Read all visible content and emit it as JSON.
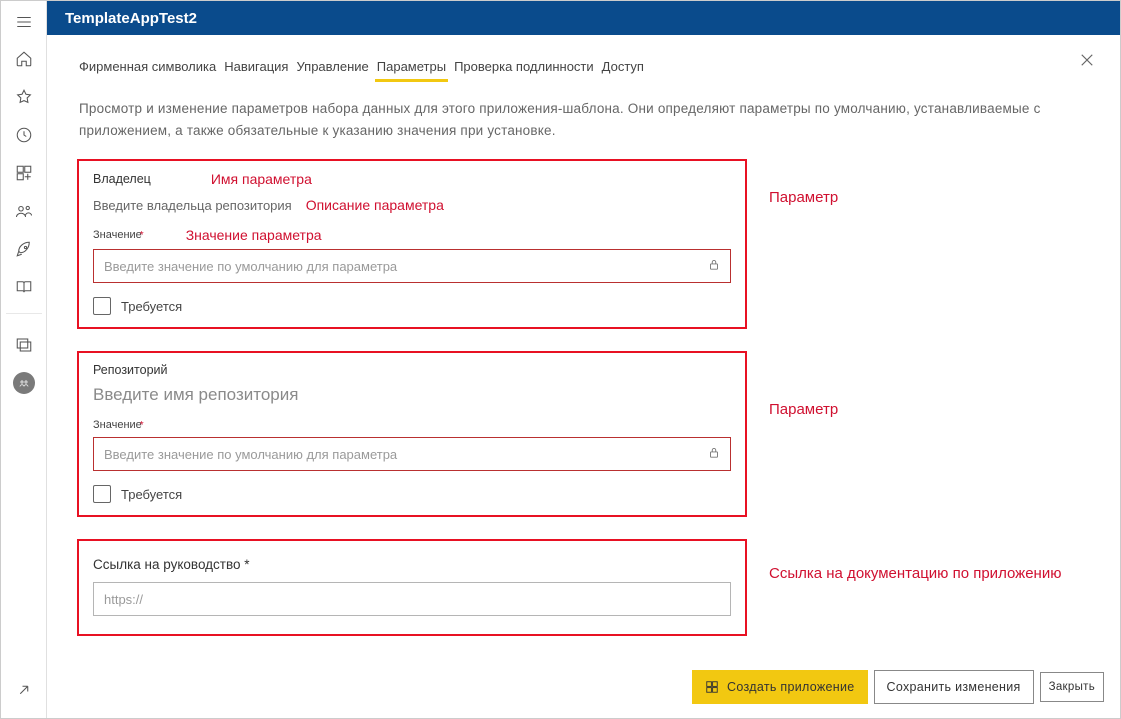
{
  "header": {
    "title": "TemplateAppTest2"
  },
  "tabs": [
    {
      "label": "Фирменная символика"
    },
    {
      "label": "Навигация"
    },
    {
      "label": "Управление"
    },
    {
      "label": "Параметры",
      "active": true
    },
    {
      "label": "Проверка подлинности"
    },
    {
      "label": "Доступ"
    }
  ],
  "description": "Просмотр и изменение параметров набора данных для этого приложения-шаблона. Они определяют параметры по умолчанию, устанавливаемые с приложением, а также обязательные к указанию значения при установке.",
  "param1": {
    "name": "Владелец",
    "name_hint": "Имя параметра",
    "desc": "Введите владельца репозитория",
    "desc_hint": "Описание параметра",
    "value_label": "Значение",
    "value_hint": "Значение параметра",
    "placeholder": "Введите значение по умолчанию для параметра",
    "required_label": "Требуется",
    "annotation": "Параметр"
  },
  "param2": {
    "name": "Репозиторий",
    "desc": "Введите имя репозитория",
    "value_label": "Значение",
    "placeholder": "Введите значение по умолчанию для параметра",
    "required_label": "Требуется",
    "annotation": "Параметр"
  },
  "guide": {
    "label": "Ссылка на руководство *",
    "placeholder": "https://",
    "annotation": "Ссылка на документацию по приложению"
  },
  "footer": {
    "create": "Создать приложение",
    "save": "Сохранить изменения",
    "close": "Закрыть"
  }
}
